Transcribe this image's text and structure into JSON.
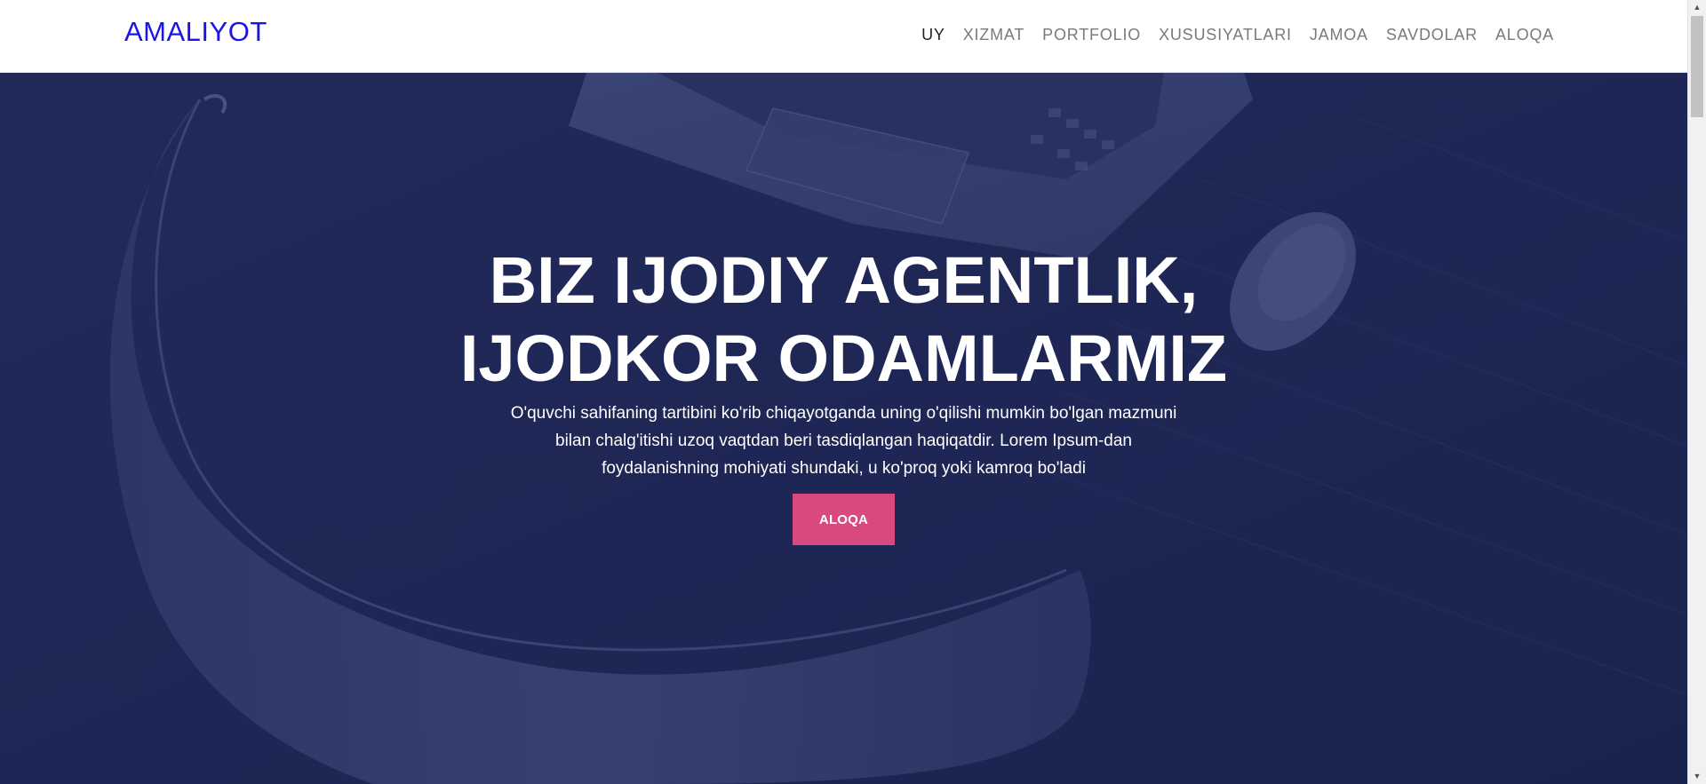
{
  "navbar": {
    "brand": "AMALIYOT",
    "links": [
      {
        "label": "UY",
        "active": true
      },
      {
        "label": "XIZMAT",
        "active": false
      },
      {
        "label": "PORTFOLIO",
        "active": false
      },
      {
        "label": "XUSUSIYATLARI",
        "active": false
      },
      {
        "label": "JAMOA",
        "active": false
      },
      {
        "label": "SAVDOLAR",
        "active": false
      },
      {
        "label": "ALOQA",
        "active": false
      }
    ]
  },
  "hero": {
    "title": "BIZ IJODIY AGENTLIK, IJODKOR ODAMLARMIZ",
    "description": "O'quvchi sahifaning tartibini ko'rib chiqayotganda uning o'qilishi mumkin bo'lgan mazmuni bilan chalg'itishi uzoq vaqtdan beri tasdiqlangan haqiqatdir. Lorem Ipsum-dan foydalanishning mohiyati shundaki, u ko'proq yoki kamroq bo'ladi",
    "button_label": "ALOQA",
    "background_image": "laptop-and-mouse-on-desk-photo"
  },
  "colors": {
    "brand": "#1a14e6",
    "nav_text": "#7a7a7a",
    "nav_active": "#222222",
    "hero_overlay": "#1c2452",
    "button": "#d84a7f"
  },
  "scrollbar": {
    "up_icon": "chevron-up-icon",
    "down_icon": "chevron-down-icon"
  }
}
